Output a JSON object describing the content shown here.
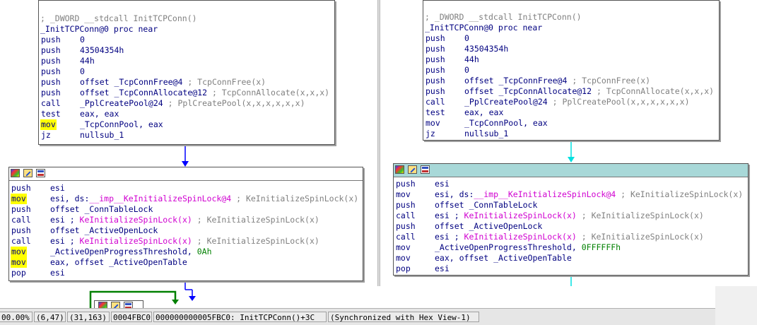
{
  "left": {
    "block1": {
      "header": "; _DWORD __stdcall InitTCPConn()",
      "proc": "_InitTCPConn@0 proc near",
      "lines": [
        {
          "m": "push",
          "o": "0"
        },
        {
          "m": "push",
          "o": "43504354h"
        },
        {
          "m": "push",
          "o": "44h"
        },
        {
          "m": "push",
          "o": "0"
        },
        {
          "m": "push",
          "o": "offset _TcpConnFree@4",
          "c": " ; TcpConnFree(x)"
        },
        {
          "m": "push",
          "o": "offset _TcpConnAllocate@12",
          "c": " ; TcpConnAllocate(x,x,x)"
        },
        {
          "m": "call",
          "o": "_PplCreatePool@24",
          "c": " ; PplCreatePool(x,x,x,x,x,x)"
        },
        {
          "m": "test",
          "o": "eax, eax"
        },
        {
          "m": "mov",
          "o": "_TcpConnPool, eax",
          "hl": true
        },
        {
          "m": "jz",
          "o": "nullsub_1"
        }
      ]
    },
    "block2": {
      "lines": [
        {
          "m": "push",
          "o": "esi"
        },
        {
          "m": "mov",
          "o": "esi, ds:",
          "o2": "__imp__KeInitializeSpinLock@4",
          "c": " ; KeInitializeSpinLock(x)",
          "hl": true
        },
        {
          "m": "push",
          "o": "offset _ConnTableLock"
        },
        {
          "m": "call",
          "o": "esi ; ",
          "o2": "KeInitializeSpinLock(x)",
          "c": " ; KeInitializeSpinLock(x)"
        },
        {
          "m": "push",
          "o": "offset _ActiveOpenLock"
        },
        {
          "m": "call",
          "o": "esi ; ",
          "o2": "KeInitializeSpinLock(x)",
          "c": " ; KeInitializeSpinLock(x)"
        },
        {
          "m": "mov",
          "o": "_ActiveOpenProgressThreshold, ",
          "n": "0Ah",
          "hl": true
        },
        {
          "m": "mov",
          "o": "eax, offset _ActiveOpenTable",
          "hl": true
        },
        {
          "m": "pop",
          "o": "esi"
        }
      ]
    }
  },
  "right": {
    "block1": {
      "header": "; _DWORD __stdcall InitTCPConn()",
      "proc": "_InitTCPConn@0 proc near",
      "lines": [
        {
          "m": "push",
          "o": "0"
        },
        {
          "m": "push",
          "o": "43504354h"
        },
        {
          "m": "push",
          "o": "44h"
        },
        {
          "m": "push",
          "o": "0"
        },
        {
          "m": "push",
          "o": "offset _TcpConnFree@4",
          "c": " ; TcpConnFree(x)"
        },
        {
          "m": "push",
          "o": "offset _TcpConnAllocate@12",
          "c": " ; TcpConnAllocate(x,x,x)"
        },
        {
          "m": "call",
          "o": "_PplCreatePool@24",
          "c": " ; PplCreatePool(x,x,x,x,x,x)"
        },
        {
          "m": "test",
          "o": "eax, eax"
        },
        {
          "m": "mov",
          "o": "_TcpConnPool, eax"
        },
        {
          "m": "jz",
          "o": "nullsub_1"
        }
      ]
    },
    "block2": {
      "lines": [
        {
          "m": "push",
          "o": "esi"
        },
        {
          "m": "mov",
          "o": "esi, ds:",
          "o2": "__imp__KeInitializeSpinLock@4",
          "c": " ; KeInitializeSpinLock(x)"
        },
        {
          "m": "push",
          "o": "offset _ConnTableLock"
        },
        {
          "m": "call",
          "o": "esi ; ",
          "o2": "KeInitializeSpinLock(x)",
          "c": " ; KeInitializeSpinLock(x)"
        },
        {
          "m": "push",
          "o": "offset _ActiveOpenLock"
        },
        {
          "m": "call",
          "o": "esi ; ",
          "o2": "KeInitializeSpinLock(x)",
          "c": " ; KeInitializeSpinLock(x)"
        },
        {
          "m": "mov",
          "o": "_ActiveOpenProgressThreshold, ",
          "n": "0FFFFFFh"
        },
        {
          "m": "mov",
          "o": "eax, offset _ActiveOpenTable"
        },
        {
          "m": "pop",
          "o": "esi"
        }
      ]
    }
  },
  "status_bar": {
    "zoom": "00.00%",
    "cursor": "(6,47)",
    "graph_pos": "(31,163)",
    "offset": "0004FBC0",
    "address": "000000000005FBC0: InitTCPConn()+3C",
    "sync": "(Synchronized with Hex View-1)"
  },
  "colors": {
    "highlight": "#ffff00",
    "mnemonic": "#000080",
    "comment": "#808080",
    "import_name": "#d000d0",
    "number": "#008000",
    "left_edge": "#0000ff",
    "right_edge": "#00e0e0",
    "loop_edge": "#008000",
    "teal_title": "#a8d8d8"
  }
}
